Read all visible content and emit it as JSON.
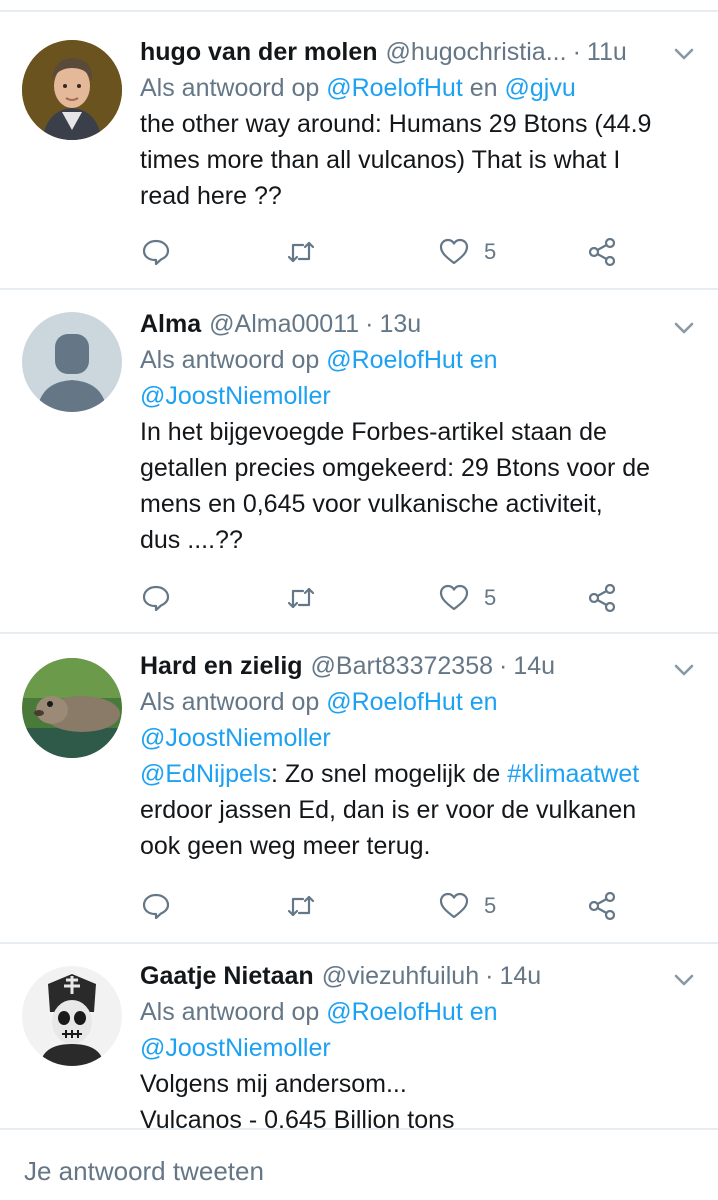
{
  "tweets": [
    {
      "name": "hugo van der molen",
      "handle": "@hugochristia...",
      "dot": "·",
      "time": "11u",
      "reply_prefix": "Als antwoord op ",
      "reply_user1": "@RoelofHut",
      "reply_join": " en ",
      "reply_user2": "@gjvu",
      "text1": "the other way around: Humans 29 Btons (44.9",
      "text2": "times more than all vulcanos) That is what I",
      "text3": "read here ??",
      "likes": "5"
    },
    {
      "name": "Alma",
      "handle": "@Alma00011",
      "dot": "·",
      "time": "13u",
      "reply_prefix": "Als antwoord op ",
      "reply_user1": "@RoelofHut",
      "reply_join": " en",
      "reply_user2": "@JoostNiemoller",
      "text1": "In het bijgevoegde Forbes-artikel staan de",
      "text2": "getallen precies omgekeerd: 29 Btons voor de",
      "text3": "mens en 0,645 voor vulkanische activiteit,",
      "text4": "dus ....??",
      "likes": "5"
    },
    {
      "name": "Hard en zielig",
      "handle": "@Bart83372358",
      "dot": "·",
      "time": "14u",
      "reply_prefix": "Als antwoord op ",
      "reply_user1": "@RoelofHut",
      "reply_join": " en",
      "reply_user2": "@JoostNiemoller",
      "mention": "@EdNijpels",
      "text1_rest": ": Zo snel mogelijk de ",
      "hashtag": "#klimaatwet",
      "text2": "erdoor jassen Ed, dan is er voor de vulkanen",
      "text3": "ook geen weg meer terug.",
      "likes": "5"
    },
    {
      "name": "Gaatje Nietaan",
      "handle": "@viezuhfuiluh",
      "dot": "·",
      "time": "14u",
      "reply_prefix": "Als antwoord op ",
      "reply_user1": "@RoelofHut",
      "reply_join": " en",
      "reply_user2": "@JoostNiemoller",
      "text1": "Volgens mij andersom...",
      "text2": "Vulcanos - 0,645 Billion tons"
    }
  ],
  "compose": {
    "placeholder": "Je antwoord tweeten"
  },
  "icons": {
    "reply": "reply-icon",
    "retweet": "retweet-icon",
    "like": "heart-icon",
    "share": "share-icon",
    "more": "chevron-down-icon"
  },
  "colors": {
    "link": "#1da1f2",
    "secondary": "#657786",
    "border": "#e6ecf0",
    "text": "#14171a"
  }
}
